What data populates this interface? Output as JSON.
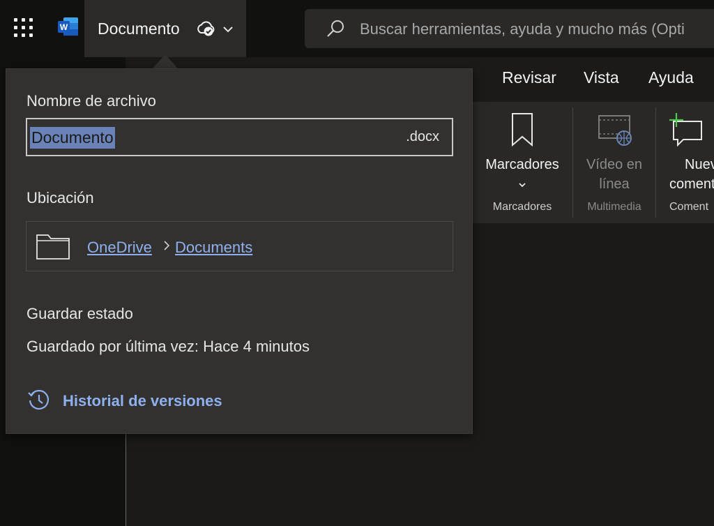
{
  "app": {
    "document_title": "Documento",
    "search_placeholder": "Buscar herramientas, ayuda y mucho más (Opti",
    "word_logo_letter": "W"
  },
  "ribbon_tabs": [
    "Revisar",
    "Vista",
    "Ayuda"
  ],
  "ribbon": {
    "bookmarks_label": "Marcadores",
    "bookmarks_group": "Marcadores",
    "video_line1": "Vídeo en",
    "video_line2": "línea",
    "media_group": "Multimedia",
    "comment_line1": "Nuev",
    "comment_line2": "coment",
    "comments_group": "Coment"
  },
  "popup": {
    "filename_label": "Nombre de archivo",
    "filename_value": "Documento",
    "filename_ext": ".docx",
    "location_label": "Ubicación",
    "location_path": [
      "OneDrive",
      "Documents"
    ],
    "save_state_label": "Guardar estado",
    "save_state_text": "Guardado por última vez: Hace 4 minutos",
    "version_history": "Historial de versiones"
  },
  "colors": {
    "accent_link": "#8fb0ee",
    "selection": "#6983b8",
    "word_blue": "#185abd",
    "comment_plus": "#4ec94e"
  },
  "icons": [
    "app-launcher-icon",
    "word-logo-icon",
    "cloud-saved-icon",
    "chevron-down-icon",
    "search-icon",
    "bookmark-icon",
    "online-video-icon",
    "new-comment-icon",
    "folder-icon",
    "breadcrumb-chevron-icon",
    "history-icon"
  ]
}
